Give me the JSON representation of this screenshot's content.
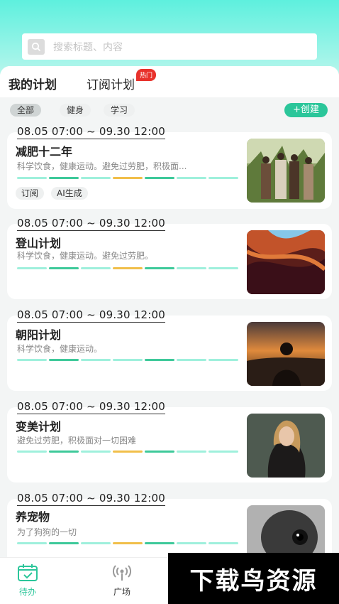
{
  "search": {
    "placeholder": "搜索标题、内容"
  },
  "tabs": {
    "mine": "我的计划",
    "subscribed": "订阅计划",
    "hot_badge": "热门"
  },
  "filters": {
    "items": [
      "全部",
      "健身",
      "学习"
    ],
    "create_label": "+创建"
  },
  "plans": [
    {
      "date": "08.05 07:00 ~ 09.30 12:00",
      "title": "减肥十二年",
      "desc": "科学饮食，健康运动。避免过劳肥，积极面...",
      "tags": [
        "订阅",
        "AI生成"
      ]
    },
    {
      "date": "08.05 07:00 ~ 09.30 12:00",
      "title": "登山计划",
      "desc": "科学饮食，健康运动。避免过劳肥。",
      "tags": []
    },
    {
      "date": "08.05 07:00 ~ 09.30 12:00",
      "title": "朝阳计划",
      "desc": "科学饮食，健康运动。",
      "tags": []
    },
    {
      "date": "08.05 07:00 ~ 09.30 12:00",
      "title": "变美计划",
      "desc": "避免过劳肥，积极面对一切困难",
      "tags": []
    },
    {
      "date": "08.05 07:00 ~ 09.30 12:00",
      "title": "养宠物",
      "desc": "为了狗狗的一切",
      "tags": []
    }
  ],
  "nav": {
    "todo": "待办",
    "square": "广场"
  },
  "watermark": "下载鸟资源",
  "colors": {
    "accent": "#2bc69a",
    "hot": "#e8322c",
    "tab_underline": "#f7c64a"
  }
}
